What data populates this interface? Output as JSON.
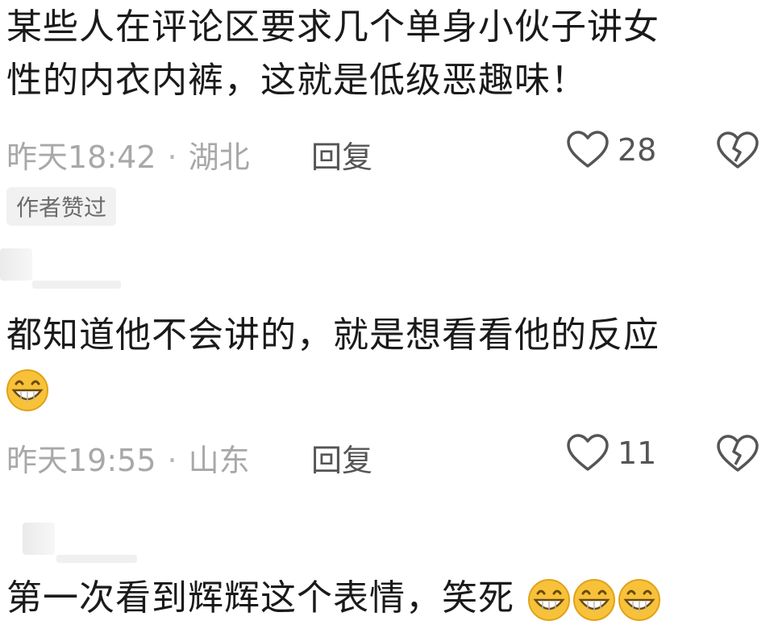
{
  "comments": [
    {
      "text_line1": "某些人在评论区要求几个单身小伙子讲女",
      "text_line2": "性的内衣内裤，这就是低级恶趣味！",
      "time": "昨天18:42",
      "location": "湖北",
      "reply_label": "回复",
      "likes": "28",
      "badge": "作者赞过"
    },
    {
      "text_line1": "都知道他不会讲的，就是想看看他的反应",
      "time": "昨天19:55",
      "location": "山东",
      "reply_label": "回复",
      "likes": "11",
      "emoji_count": 1
    },
    {
      "text_line1": "第一次看到辉辉这个表情，笑死",
      "emoji_count": 3
    }
  ],
  "separator": "·",
  "colors": {
    "meta_gray": "#a8a8a8",
    "text": "#1a1a1a",
    "emoji_face": "#f7c23a"
  },
  "icons": [
    "heart-outline-icon",
    "broken-heart-icon",
    "grinning-emoji-icon"
  ]
}
